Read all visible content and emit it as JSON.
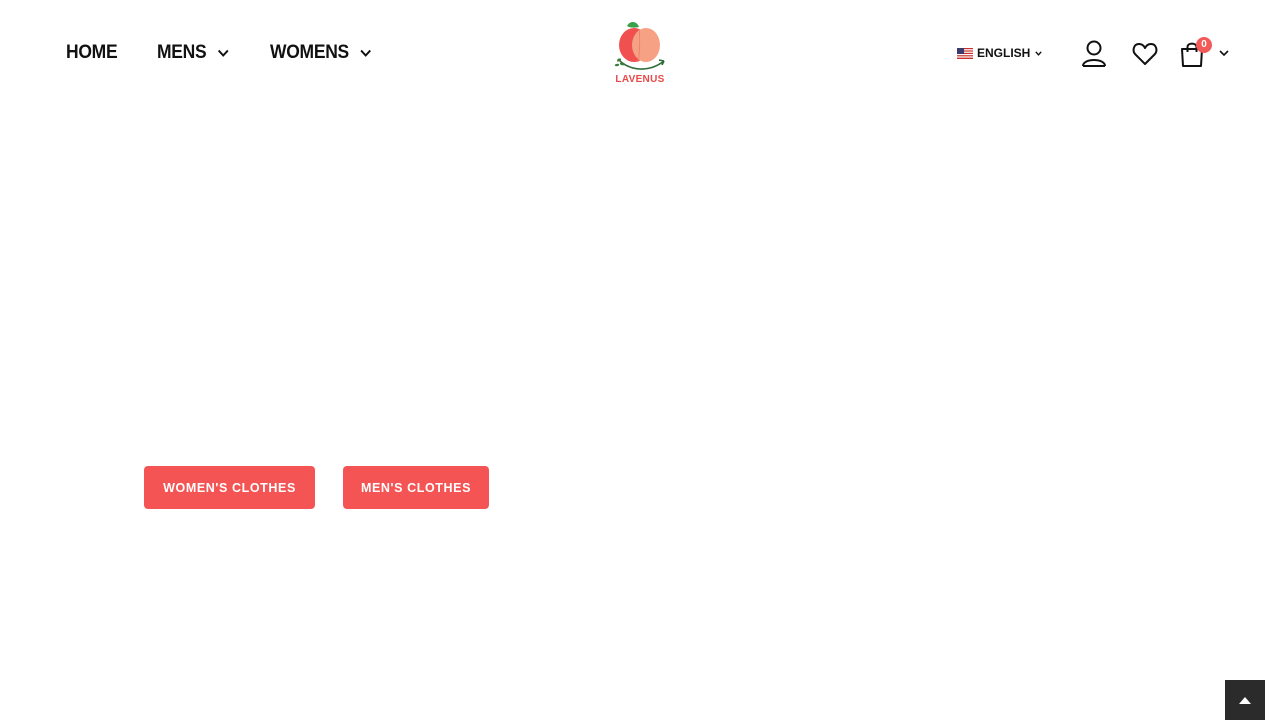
{
  "header": {
    "nav": [
      {
        "label": "HOME",
        "has_dropdown": false
      },
      {
        "label": "MENS",
        "has_dropdown": true
      },
      {
        "label": "WOMENS",
        "has_dropdown": true
      }
    ],
    "logo_text": "LAVENUS",
    "language": {
      "label": "ENGLISH",
      "flag": "us-flag-icon"
    },
    "cart_count": "0",
    "icons": [
      "user-icon",
      "heart-icon",
      "shopping-bag-icon"
    ]
  },
  "hero": {
    "women_button": "WOMEN'S CLOTHES",
    "men_button": "MEN'S CLOTHES"
  },
  "colors": {
    "accent": "#f45454",
    "badge": "#f25a5a",
    "logo_text": "#e84a4a",
    "back_to_top_bg": "#2b2b2b"
  }
}
